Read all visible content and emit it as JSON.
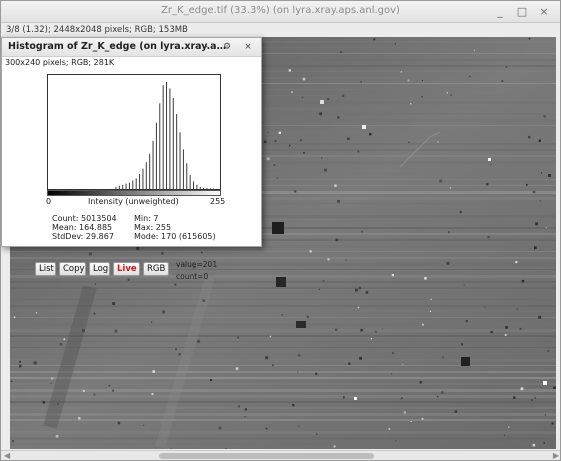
{
  "window": {
    "title": "Zr_K_edge.tif (33.3%) (on lyra.xray.aps.anl.gov)",
    "status": "3/8 (1.32); 2448x2048 pixels; RGB; 153MB",
    "minimize_glyph": "_",
    "maximize_glyph": "□",
    "close_glyph": "×"
  },
  "histogram_window": {
    "title": "Histogram of Zr_K_edge (on lyra.xray.a…",
    "subtitle": "300x240 pixels; RGB; 281K",
    "minimize_glyph": "–",
    "maximize_glyph": "⚙",
    "close_glyph": "×",
    "axis": {
      "min_label": "0",
      "max_label": "255",
      "center_label": "Intensity (unweighted)"
    },
    "stats": {
      "count": "Count: 5013504",
      "mean": "Mean: 164.885",
      "stddev": "StdDev: 29.867",
      "min": "Min: 7",
      "max": "Max: 255",
      "mode": "Mode: 170 (615605)"
    },
    "buttons": {
      "list": "List",
      "copy": "Copy",
      "log": "Log",
      "live": "Live",
      "rgb": "RGB"
    },
    "readout": {
      "value": "value=201",
      "count": "count=0"
    },
    "chart_data": {
      "type": "bar",
      "x_range": [
        0,
        255
      ],
      "bin_step": 5,
      "bins_x": [
        100,
        105,
        110,
        115,
        120,
        125,
        130,
        135,
        140,
        145,
        150,
        155,
        160,
        165,
        170,
        175,
        180,
        185,
        190,
        195,
        200,
        205,
        210,
        215,
        220,
        225,
        230,
        235,
        240,
        245,
        250,
        255
      ],
      "relative_heights": [
        0.02,
        0.03,
        0.04,
        0.05,
        0.06,
        0.08,
        0.1,
        0.14,
        0.19,
        0.25,
        0.33,
        0.45,
        0.62,
        0.8,
        0.97,
        1.0,
        0.94,
        0.85,
        0.7,
        0.53,
        0.37,
        0.24,
        0.13,
        0.07,
        0.04,
        0.02,
        0.01,
        0.01,
        0.005,
        0.003,
        0.002,
        0.02
      ]
    }
  }
}
